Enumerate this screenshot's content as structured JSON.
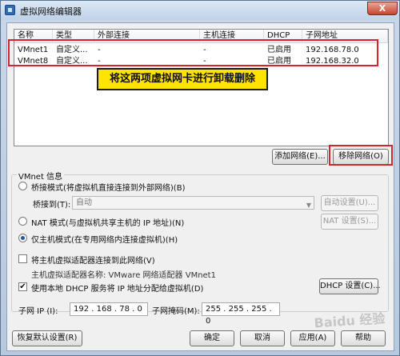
{
  "window": {
    "title": "虚拟网络编辑器",
    "close_label": "X"
  },
  "list": {
    "headers": [
      "名称",
      "类型",
      "外部连接",
      "主机连接",
      "DHCP",
      "子网地址"
    ],
    "rows": [
      [
        "VMnet1",
        "自定义...",
        "-",
        "-",
        "已启用",
        "192.168.78.0"
      ],
      [
        "VMnet8",
        "自定义...",
        "-",
        "-",
        "已启用",
        "192.168.32.0"
      ]
    ]
  },
  "annotation": {
    "text": "将这两项虚拟网卡进行卸载删除",
    "highlight_color": "#d4242c",
    "box_color": "#ffe400"
  },
  "actions": {
    "add_network": "添加网络(E)...",
    "remove_network": "移除网络(O)"
  },
  "vmnet_info": {
    "label": "VMnet 信息",
    "bridge_mode": "桥接模式(将虚拟机直接连接到外部网络)(B)",
    "bridge_to_label": "桥接到(T):",
    "bridge_to_value": "自动",
    "auto_settings": "自动设置(U)...",
    "nat_mode": "NAT 模式(与虚拟机共享主机的 IP 地址)(N)",
    "nat_settings": "NAT 设置(S)...",
    "host_only_mode": "仅主机模式(在专用网络内连接虚拟机)(H)",
    "connect_host_adapter": "将主机虚拟适配器连接到此网络(V)",
    "host_adapter_name": "主机虚拟适配器名称: VMware 网络适配器 VMnet1",
    "use_dhcp": "使用本地 DHCP 服务将 IP 地址分配给虚拟机(D)",
    "dhcp_settings": "DHCP 设置(C)...",
    "subnet_ip_label": "子网 IP (I):",
    "subnet_ip_value": "192 . 168 . 78 .  0",
    "subnet_mask_label": "子网掩码(M):",
    "subnet_mask_value": "255 . 255 . 255 .  0",
    "selected_mode": "host_only"
  },
  "footer": {
    "restore_defaults": "恢复默认设置(R)",
    "ok": "确定",
    "cancel": "取消",
    "apply": "应用(A)",
    "help": "帮助"
  },
  "watermark": "Baidu 经验"
}
